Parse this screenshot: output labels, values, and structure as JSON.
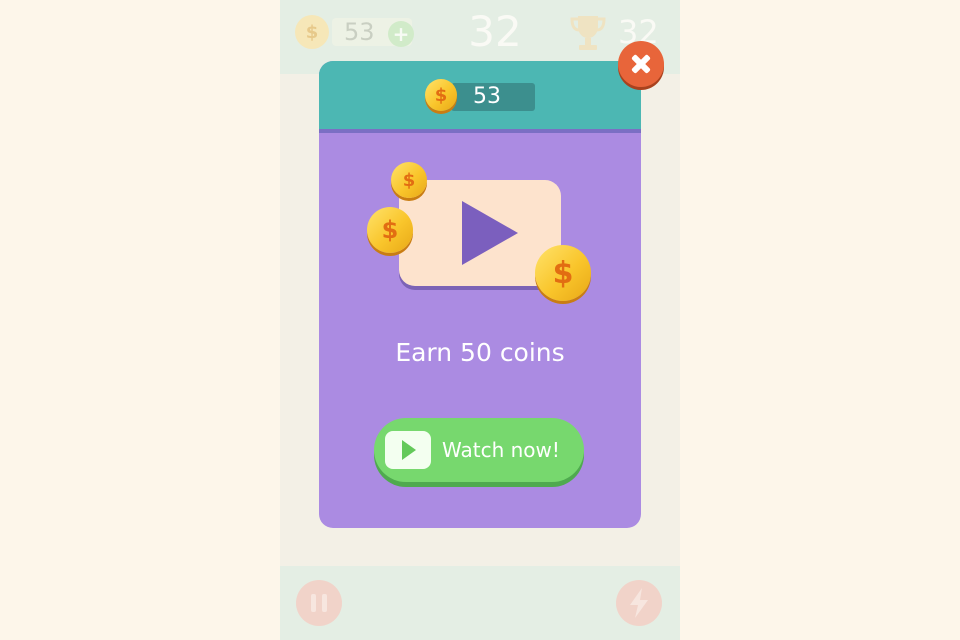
{
  "hud": {
    "coins": "53",
    "coin_symbol": "$",
    "add_symbol": "+",
    "score": "32",
    "best": "32"
  },
  "modal": {
    "coin_balance": "53",
    "coin_symbol": "$",
    "earn_text": "Earn 50 coins",
    "watch_button_label": "Watch now!"
  },
  "colors": {
    "page_bg": "#fdf6ea",
    "modal_body": "#ab8be2",
    "modal_header": "#4cb7b3",
    "watch_button": "#77d86e",
    "close_button": "#e8653a",
    "coin_gold": "#f9c52b"
  },
  "icons": [
    "coin-icon",
    "plus-icon",
    "trophy-icon",
    "pause-icon",
    "lightning-icon",
    "play-icon",
    "close-icon"
  ]
}
